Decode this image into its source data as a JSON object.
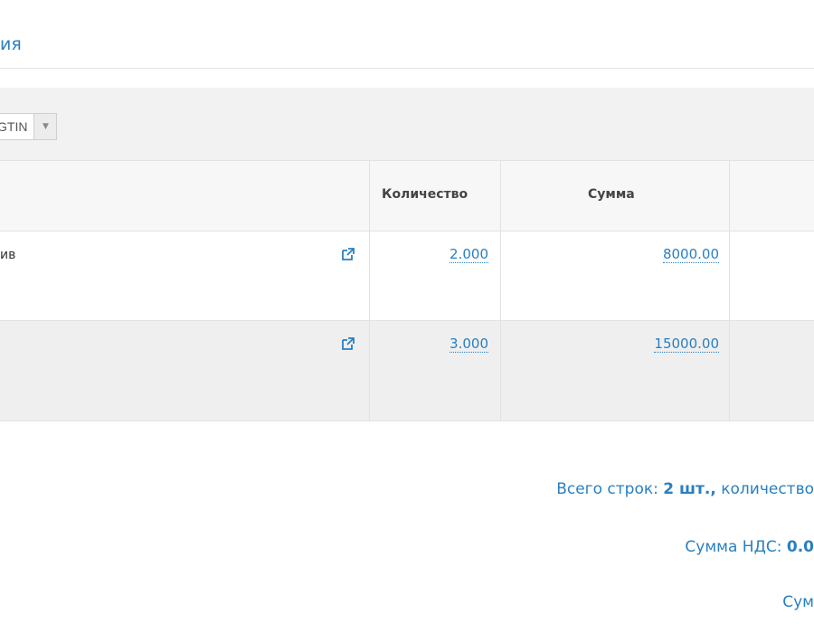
{
  "section": {
    "title": "ия"
  },
  "filter": {
    "gtin_select_value": "GTIN"
  },
  "table": {
    "headers": {
      "quantity": "Количество",
      "sum": "Сумма"
    },
    "rows": [
      {
        "name": "ив",
        "quantity": "2.000",
        "sum": "8000.00"
      },
      {
        "name": "",
        "quantity": "3.000",
        "sum": "15000.00"
      }
    ]
  },
  "summary": {
    "rows_label": "Всего строк: ",
    "rows_value": "2 шт.,",
    "rows_suffix": " количество",
    "vat_label": "Сумма НДС: ",
    "vat_value": "0.0",
    "total_label": "Сум"
  },
  "colors": {
    "accent": "#2a7fc0",
    "header_bg": "#f7f7f7",
    "alt_row_bg": "#efefef"
  },
  "icons": {
    "external_link": "external-link-icon",
    "dropdown": "caret-down-icon"
  }
}
